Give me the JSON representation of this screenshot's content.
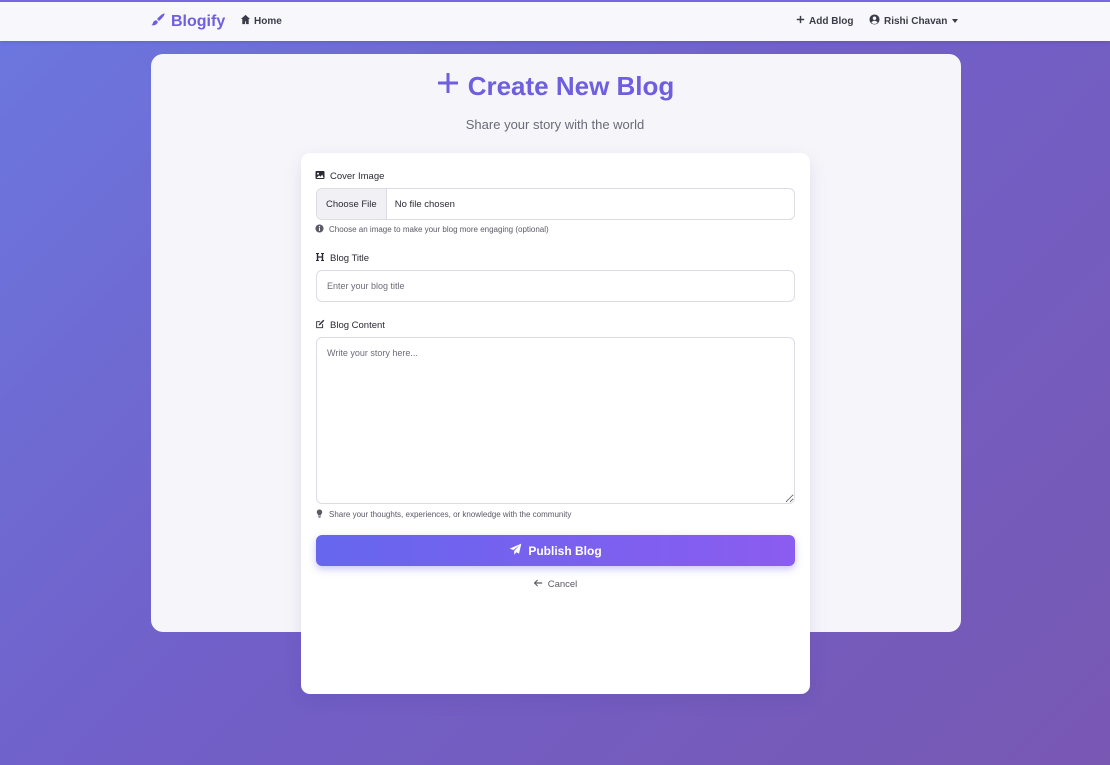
{
  "navbar": {
    "brand": "Blogify",
    "home_label": "Home",
    "add_blog_label": "Add Blog",
    "user_name": "Rishi Chavan",
    "brand_icon": "feather-brush-icon",
    "home_icon": "home-icon",
    "add_icon": "plus-icon",
    "user_icon": "user-circle-icon"
  },
  "page": {
    "title": "Create New Blog",
    "subtitle": "Share your story with the world"
  },
  "form": {
    "cover_label": "Cover Image",
    "choose_file_label": "Choose File",
    "file_status": "No file chosen",
    "cover_help": "Choose an image to make your blog more engaging (optional)",
    "title_label": "Blog Title",
    "title_placeholder": "Enter your blog title",
    "title_value": "",
    "content_label": "Blog Content",
    "content_placeholder": "Write your story here...",
    "content_value": "",
    "content_help": "Share your thoughts, experiences, or knowledge with the community",
    "publish_label": "Publish Blog",
    "cancel_label": "Cancel"
  },
  "colors": {
    "accent": "#6e5ee0",
    "button_start": "#6666ee",
    "button_end": "#8b5cf0",
    "background_start": "#6b78df",
    "background_end": "#7858b3"
  }
}
